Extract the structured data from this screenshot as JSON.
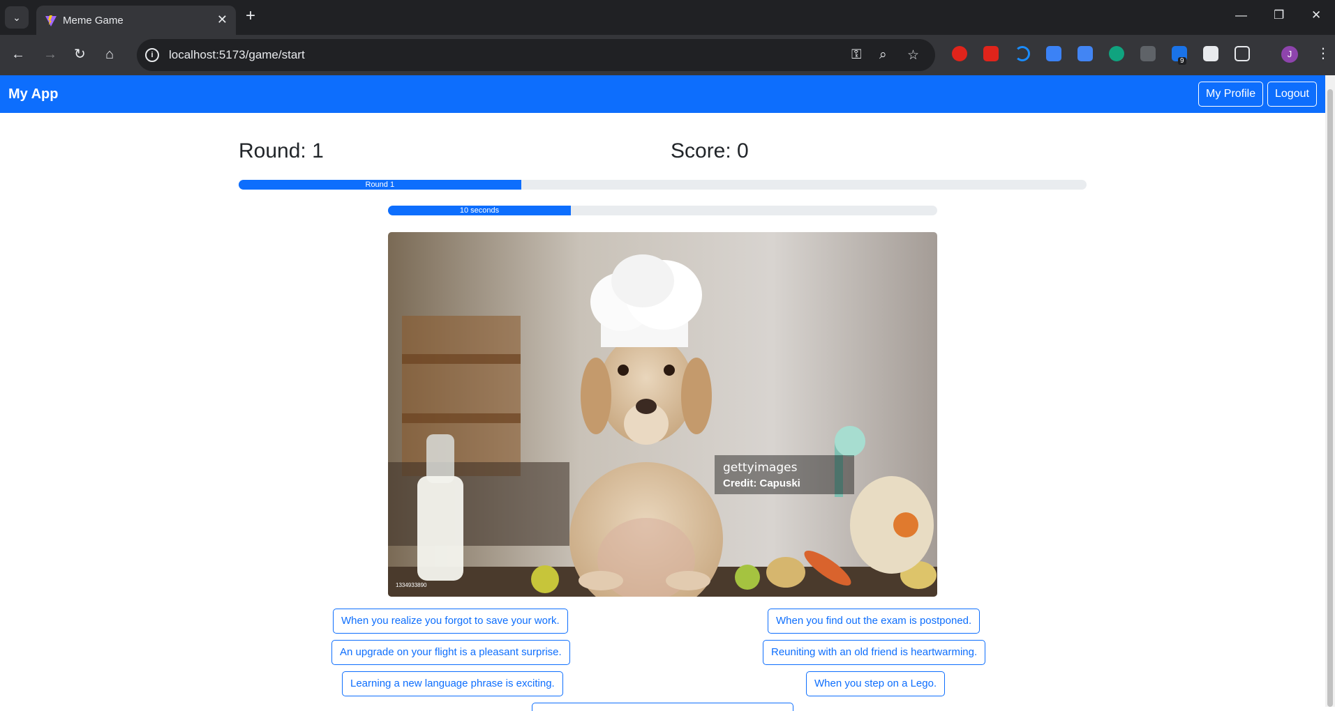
{
  "browser": {
    "tab_title": "Meme Game",
    "url": "localhost:5173/game/start",
    "avatar_initial": "J",
    "extension_badge": "9"
  },
  "app": {
    "brand": "My App",
    "profile_label": "My Profile",
    "logout_label": "Logout",
    "accent_color": "#0d6efd"
  },
  "game": {
    "round_text": "Round: 1",
    "score_text": "Score: 0",
    "round_bar_label": "Round 1",
    "round_progress": 0.333,
    "timer_label": "10 seconds",
    "timer_progress": 0.333,
    "meme": {
      "watermark_brand": "gettyimages",
      "watermark_credit": "Credit: Capuski",
      "image_id": "1334933890"
    },
    "captions": [
      "When you realize you forgot to save your work.",
      "When you find out the exam is postponed.",
      "An upgrade on your flight is a pleasant surprise.",
      "Reuniting with an old friend is heartwarming.",
      "Learning a new language phrase is exciting.",
      "When you step on a Lego."
    ]
  }
}
